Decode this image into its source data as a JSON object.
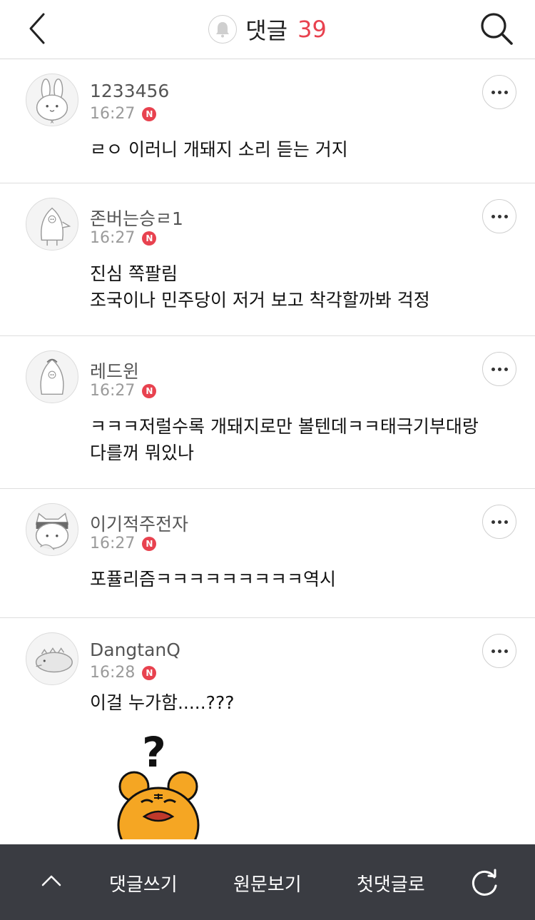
{
  "header": {
    "title": "댓글",
    "count": "39"
  },
  "comments": [
    {
      "nickname": "1233456",
      "time": "16:27",
      "badge": "N",
      "lines": [
        "ㄹㅇ 이러니 개돼지 소리 듣는 거지"
      ],
      "avatar_icon": "rabbit-avatar-icon"
    },
    {
      "nickname": "존버는승ㄹ1",
      "time": "16:27",
      "badge": "N",
      "lines": [
        "진심 쪽팔림",
        "조국이나 민주당이 저거 보고 착각할까봐 걱정"
      ],
      "avatar_icon": "penguin-avatar-icon"
    },
    {
      "nickname": "레드윈",
      "time": "16:27",
      "badge": "N",
      "lines": [
        "ㅋㅋㅋ저럴수록 개돼지로만 볼텐데ㅋㅋ태극기부대랑",
        "다를꺼 뭐있나"
      ],
      "avatar_icon": "penguin-avatar-icon"
    },
    {
      "nickname": "이기적주전자",
      "time": "16:27",
      "badge": "N",
      "lines": [
        "포퓰리즘ㅋㅋㅋㅋㅋㅋㅋㅋㅋ역시"
      ],
      "avatar_icon": "cat-avatar-icon"
    },
    {
      "nickname": "DangtanQ",
      "time": "16:28",
      "badge": "N",
      "lines": [
        "이걸 누가함.....???"
      ],
      "avatar_icon": "dino-avatar-icon"
    }
  ],
  "sticker": {
    "icon": "confused-bear-sticker",
    "glyph": "?"
  },
  "bottom_bar": {
    "write": "댓글쓰기",
    "original": "원문보기",
    "first": "첫댓글로"
  },
  "colors": {
    "accent": "#e8424f",
    "bar_bg": "#3a3c42",
    "sticker_yellow": "#f5a623"
  }
}
